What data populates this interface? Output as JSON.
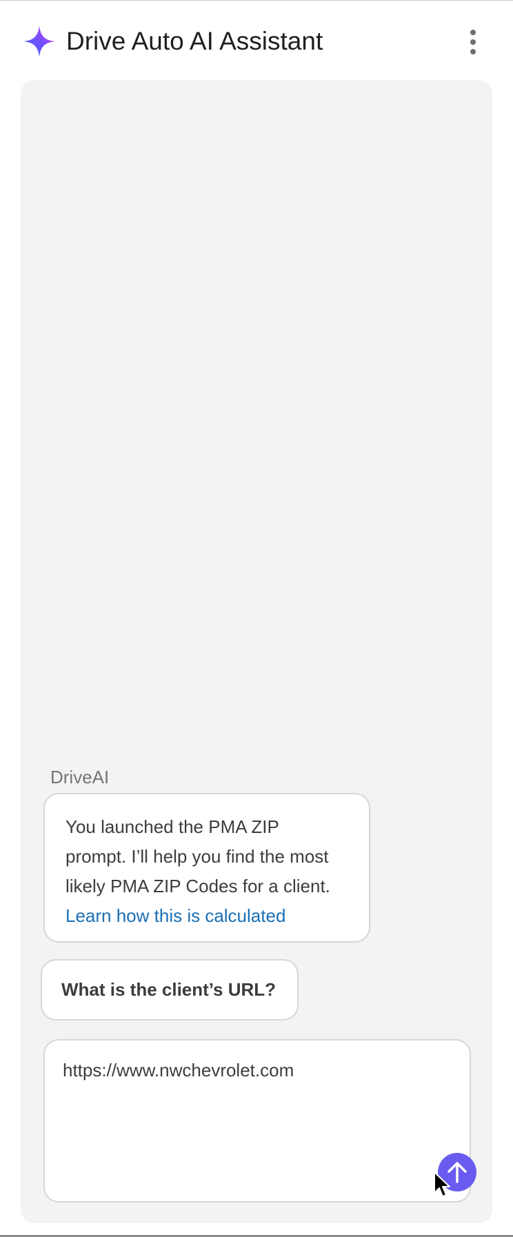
{
  "header": {
    "title": "Drive Auto AI Assistant",
    "logo_icon": "sparkle-icon",
    "menu_icon": "more-vertical-icon"
  },
  "chat": {
    "sender": "DriveAI",
    "intro_lines": [
      "You launched the PMA ZIP",
      "prompt. I’ll help you find the most",
      "likely PMA ZIP Codes for a client."
    ],
    "learn_link": "Learn how this is calculated",
    "question": "What is the client’s URL?"
  },
  "composer": {
    "value": "https://www.nwchevrolet.com",
    "send_icon": "arrow-up-icon"
  },
  "colors": {
    "accent": "#6a5cf0",
    "link": "#1a6fb5",
    "panel_bg": "#f3f3f3"
  }
}
